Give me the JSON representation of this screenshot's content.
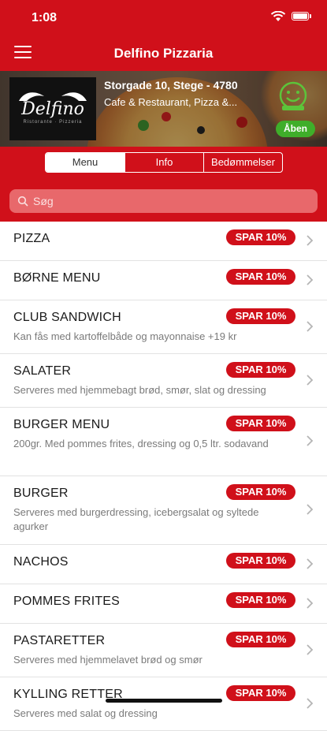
{
  "status_bar": {
    "time": "1:08"
  },
  "navbar": {
    "title": "Delfino Pizzaria",
    "menu_icon": "hamburger-icon"
  },
  "restaurant": {
    "logo_name": "Delfino",
    "logo_sub": "Ristorante · Pizzeria",
    "address": "Storgade 10, Stege - 4780",
    "categories": "Cafe & Restaurant, Pizza &...",
    "smiley_icon": "elite-smiley-icon",
    "open_status": "Åben"
  },
  "tabs": [
    {
      "label": "Menu",
      "active": true
    },
    {
      "label": "Info",
      "active": false
    },
    {
      "label": "Bedømmelser",
      "active": false
    }
  ],
  "search": {
    "placeholder": "Søg",
    "value": ""
  },
  "colors": {
    "brand_red": "#d0101a",
    "open_green": "#3fae2a",
    "search_bg": "#e8686b"
  },
  "menu_categories": [
    {
      "name": "PIZZA",
      "badge": "SPAR 10%",
      "description": ""
    },
    {
      "name": "BØRNE MENU",
      "badge": "SPAR 10%",
      "description": ""
    },
    {
      "name": "CLUB SANDWICH",
      "badge": "SPAR 10%",
      "description": "Kan fås med kartoffelbåde og mayonnaise +19 kr"
    },
    {
      "name": "SALATER",
      "badge": "SPAR 10%",
      "description": "Serveres med hjemmebagt brød, smør, slat og dressing"
    },
    {
      "name": "BURGER MENU",
      "badge": "SPAR 10%",
      "description": "200gr. Med pommes frites, dressing og 0,5 ltr. sodavand"
    },
    {
      "name": "BURGER",
      "badge": "SPAR 10%",
      "description": "Serveres med burgerdressing, icebergsalat og syltede agurker"
    },
    {
      "name": "NACHOS",
      "badge": "SPAR 10%",
      "description": ""
    },
    {
      "name": "POMMES FRITES",
      "badge": "SPAR 10%",
      "description": ""
    },
    {
      "name": "PASTARETTER",
      "badge": "SPAR 10%",
      "description": "Serveres med hjemmelavet brød og smør"
    },
    {
      "name": "KYLLING RETTER",
      "badge": "SPAR 10%",
      "description": "Serveres med salat og dressing"
    }
  ]
}
